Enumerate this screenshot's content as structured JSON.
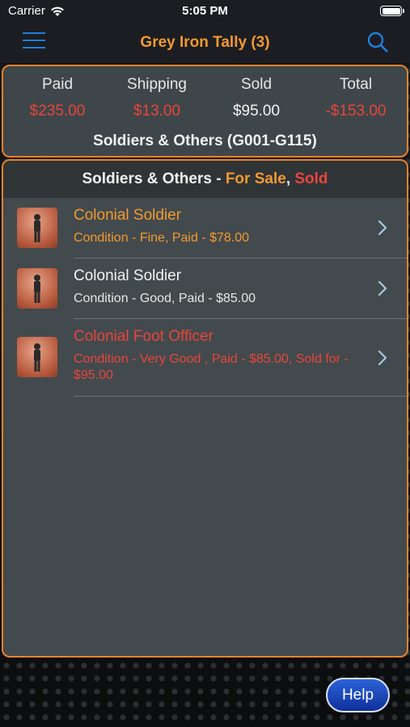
{
  "status_bar": {
    "carrier": "Carrier",
    "time": "5:05 PM"
  },
  "nav": {
    "title": "Grey Iron Tally (3)",
    "menu_icon": "hamburger-menu-icon",
    "search_icon": "magnifier-icon"
  },
  "summary": {
    "paid_label": "Paid",
    "paid_value": "$235.00",
    "shipping_label": "Shipping",
    "shipping_value": "$13.00",
    "sold_label": "Sold",
    "sold_value": "$95.00",
    "total_label": "Total",
    "total_value": "-$153.00",
    "group_name": "Soldiers & Others (G001-G115)"
  },
  "list": {
    "header_prefix": "Soldiers & Others - ",
    "header_for_sale": "For Sale",
    "header_comma": ", ",
    "header_sold": "Sold",
    "items": [
      {
        "name": "Colonial Soldier",
        "detail": "Condition - Fine, Paid - $78.00",
        "status": "for-sale"
      },
      {
        "name": "Colonial Soldier",
        "detail": "Condition - Good, Paid - $85.00",
        "status": "owned"
      },
      {
        "name": "Colonial Foot Officer",
        "detail": "Condition - Very Good , Paid - $85.00, Sold for - $95.00",
        "status": "sold"
      }
    ]
  },
  "help_button": "Help",
  "colors": {
    "accent_orange": "#f29a2e",
    "sold_red": "#e8453c",
    "link_blue": "#1e7fe0",
    "text_white": "#f2f2f2"
  }
}
